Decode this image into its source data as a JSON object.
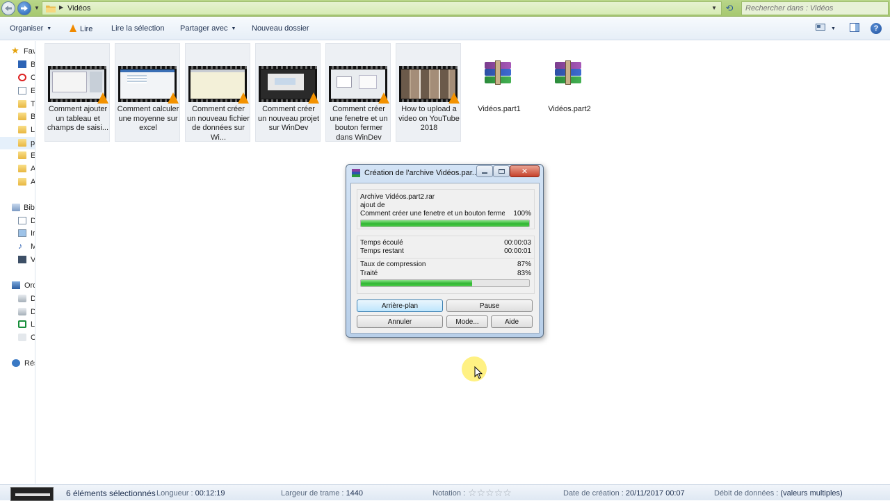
{
  "address": {
    "path": "Vidéos",
    "search_placeholder": "Rechercher dans : Vidéos"
  },
  "toolbar": {
    "organiser": "Organiser",
    "lire": "Lire",
    "lire_selection": "Lire la sélection",
    "partager": "Partager avec",
    "nouveau_dossier": "Nouveau dossier"
  },
  "nav": [
    {
      "label": "Fav",
      "icon": "star-icon"
    },
    {
      "label": "B",
      "icon": "desktop-icon"
    },
    {
      "label": "C",
      "icon": "creative-cloud-icon"
    },
    {
      "label": "E",
      "icon": "document-icon"
    },
    {
      "label": "T",
      "icon": "folder-icon"
    },
    {
      "label": "B",
      "icon": "folder-icon"
    },
    {
      "label": "L",
      "icon": "folder-icon"
    },
    {
      "label": "p",
      "icon": "folder-icon"
    },
    {
      "label": "E",
      "icon": "folder-icon"
    },
    {
      "label": "A",
      "icon": "folder-icon"
    },
    {
      "label": "A",
      "icon": "folder-icon"
    },
    {
      "label": "Bib",
      "icon": "libraries-icon"
    },
    {
      "label": "D",
      "icon": "documents-icon"
    },
    {
      "label": "Ir",
      "icon": "images-icon"
    },
    {
      "label": "M",
      "icon": "music-icon"
    },
    {
      "label": "V",
      "icon": "videos-icon"
    },
    {
      "label": "Ord",
      "icon": "computer-icon"
    },
    {
      "label": "D",
      "icon": "drive-icon"
    },
    {
      "label": "D",
      "icon": "drive-icon"
    },
    {
      "label": "L",
      "icon": "drive-icon"
    },
    {
      "label": "C",
      "icon": "network-drive-icon"
    },
    {
      "label": "Rés",
      "icon": "network-icon"
    }
  ],
  "files": [
    {
      "name": "Comment ajouter un tableau et champs de saisi...",
      "type": "video"
    },
    {
      "name": "Comment calculer une moyenne sur excel",
      "type": "video"
    },
    {
      "name": "Comment créer un nouveau fichier de données sur Wi...",
      "type": "video"
    },
    {
      "name": "Comment créer un nouveau projet sur WinDev",
      "type": "video"
    },
    {
      "name": "Comment créer une fenetre et un bouton fermer dans WinDev",
      "type": "video"
    },
    {
      "name": "How to upload a video on YouTube 2018",
      "type": "video"
    },
    {
      "name": "Vidéos.part1",
      "type": "rar"
    },
    {
      "name": "Vidéos.part2",
      "type": "rar"
    }
  ],
  "dialog": {
    "title": "Création de l'archive Vidéos.par...",
    "archive": "Archive Vidéos.part2.rar",
    "action": "ajout de",
    "current_file": "Comment créer une fenetre et un bouton fermer",
    "current_percent": "100%",
    "current_progress": 1.0,
    "elapsed_label": "Temps écoulé",
    "elapsed": "00:00:03",
    "remaining_label": "Temps restant",
    "remaining": "00:00:01",
    "ratio_label": "Taux de compression",
    "ratio": "87%",
    "processed_label": "Traité",
    "processed": "83%",
    "processed_progress": 0.66,
    "btn_background": "Arrière-plan",
    "btn_pause": "Pause",
    "btn_cancel": "Annuler",
    "btn_mode": "Mode...",
    "btn_help": "Aide"
  },
  "status": {
    "selected": "6 éléments sélectionnés",
    "length_label": "Longueur :",
    "length": "00:12:19",
    "frame_width_label": "Largeur de trame :",
    "frame_width": "1440",
    "rating_label": "Notation :",
    "rating": 0,
    "created_label": "Date de création :",
    "created": "20/11/2017 00:07",
    "bitrate_label": "Débit de données :",
    "bitrate": "(valeurs multiples)"
  },
  "colors": {
    "address_bar": "#a6c870",
    "selection": "#edf0f4",
    "progress": "#2fb532",
    "dialog_frame": "#b8cfe9"
  }
}
